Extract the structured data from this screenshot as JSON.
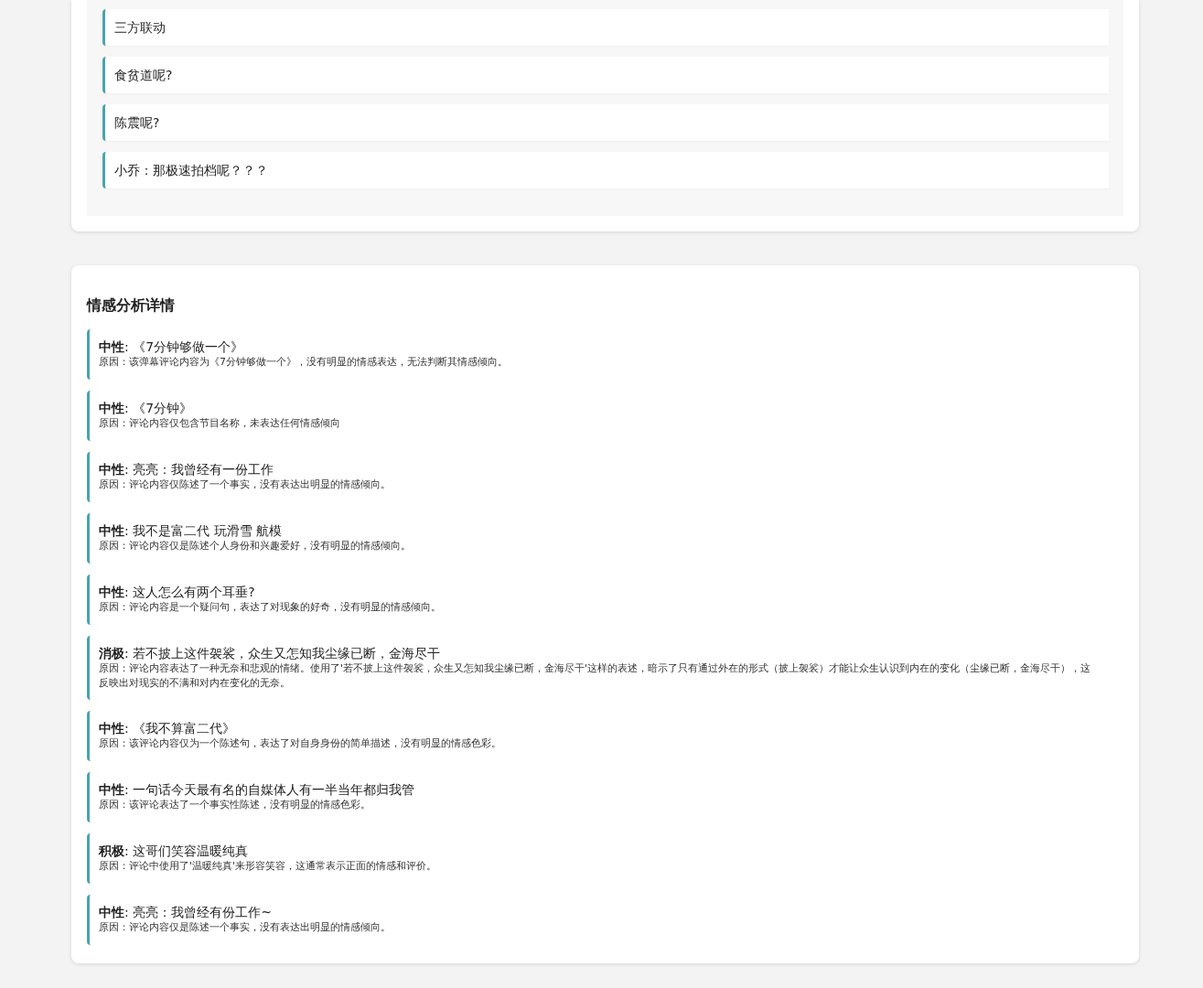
{
  "comment_list": [
    {
      "text": "三方联动"
    },
    {
      "text": "食贫道呢?"
    },
    {
      "text": "陈震呢?"
    },
    {
      "text": "小乔：那极速拍档呢？？？"
    }
  ],
  "sentiment_details": {
    "title": "情感分析详情",
    "items": [
      {
        "heading": "**中性**: 《7分钟够做一个》",
        "reason": "原因：该弹幕评论内容为《7分钟够做一个》，没有明显的情感表达，无法判断其情感倾向。"
      },
      {
        "heading": "**中性**: 《7分钟》",
        "reason": "原因：评论内容仅包含节目名称，未表达任何情感倾向"
      },
      {
        "heading": "**中性**: 亮亮：我曾经有一份工作",
        "reason": "原因：评论内容仅陈述了一个事实，没有表达出明显的情感倾向。"
      },
      {
        "heading": "**中性**: 我不是富二代 玩滑雪 航模",
        "reason": "原因：评论内容仅是陈述个人身份和兴趣爱好，没有明显的情感倾向。"
      },
      {
        "heading": "**中性**: 这人怎么有两个耳垂?",
        "reason": "原因：评论内容是一个疑问句，表达了对现象的好奇，没有明显的情感倾向。"
      },
      {
        "heading": "**消极**: 若不披上这件袈裟，众生又怎知我尘缘已断，金海尽干",
        "reason": "原因：评论内容表达了一种无奈和悲观的情绪。使用了'若不披上这件袈裟，众生又怎知我尘缘已断，金海尽干'这样的表述，暗示了只有通过外在的形式（披上袈裟）才能让众生认识到内在的变化（尘缘已断，金海尽干），这反映出对现实的不满和对内在变化的无奈。"
      },
      {
        "heading": "**中性**: 《我不算富二代》",
        "reason": "原因：该评论内容仅为一个陈述句，表达了对自身身份的简单描述，没有明显的情感色彩。"
      },
      {
        "heading": "**中性**: 一句话今天最有名的自媒体人有一半当年都归我管",
        "reason": "原因：该评论表达了一个事实性陈述，没有明显的情感色彩。"
      },
      {
        "heading": "**积极**: 这哥们笑容温暖纯真",
        "reason": "原因：评论中使用了'温暖纯真'来形容笑容，这通常表示正面的情感和评价。"
      },
      {
        "heading": "**中性**: 亮亮：我曾经有份工作~",
        "reason": "原因：评论内容仅是陈述一个事实，没有表达出明显的情感倾向。"
      }
    ]
  }
}
